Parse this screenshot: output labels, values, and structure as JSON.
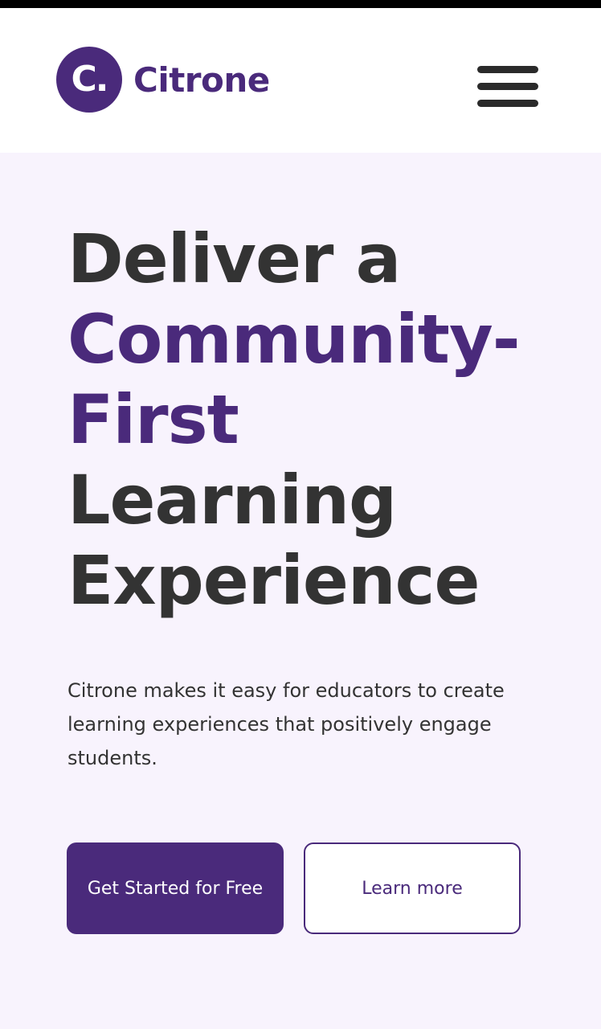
{
  "header": {
    "logo_mark": "C.",
    "logo_text": "Citrone",
    "menu_icon": "hamburger-menu-icon"
  },
  "hero": {
    "title_line1": "Deliver a",
    "title_line2": "Community-",
    "title_line3": "First",
    "title_line4": "Learning",
    "title_line5": "Experience",
    "subtitle": "Citrone makes it easy for educators to create learning experiences that positively engage students.",
    "primary_cta": "Get Started for Free",
    "secondary_cta": "Learn more"
  },
  "colors": {
    "brand": "#4a2a7b",
    "text": "#333333",
    "hero_background": "#f8f3fd",
    "header_background": "#ffffff"
  }
}
